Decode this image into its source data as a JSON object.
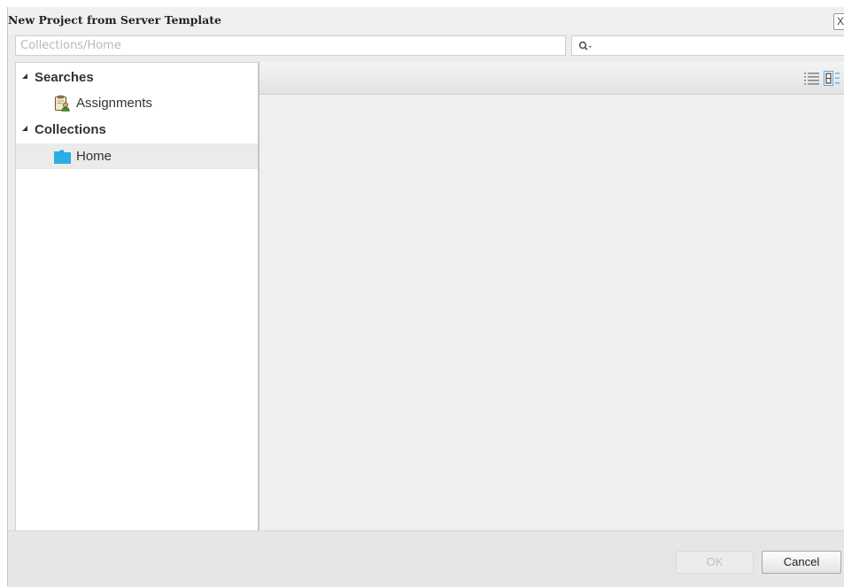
{
  "dialog": {
    "title": "New Project from Server Template",
    "close_label": "X"
  },
  "path_bar": {
    "placeholder": "Collections/Home"
  },
  "search": {
    "value": ""
  },
  "tree": {
    "searches_label": "Searches",
    "assignments_label": "Assignments",
    "collections_label": "Collections",
    "home_label": "Home"
  },
  "icons": {
    "folder_color": "#29a3dc",
    "assignments_icon": "clipboard-user-icon",
    "list_view_icon": "list-view-icon",
    "detail_view_icon": "detail-view-icon",
    "search_icon": "magnifier-dropdown-icon"
  },
  "footer": {
    "ok_label": "OK",
    "cancel_label": "Cancel"
  }
}
